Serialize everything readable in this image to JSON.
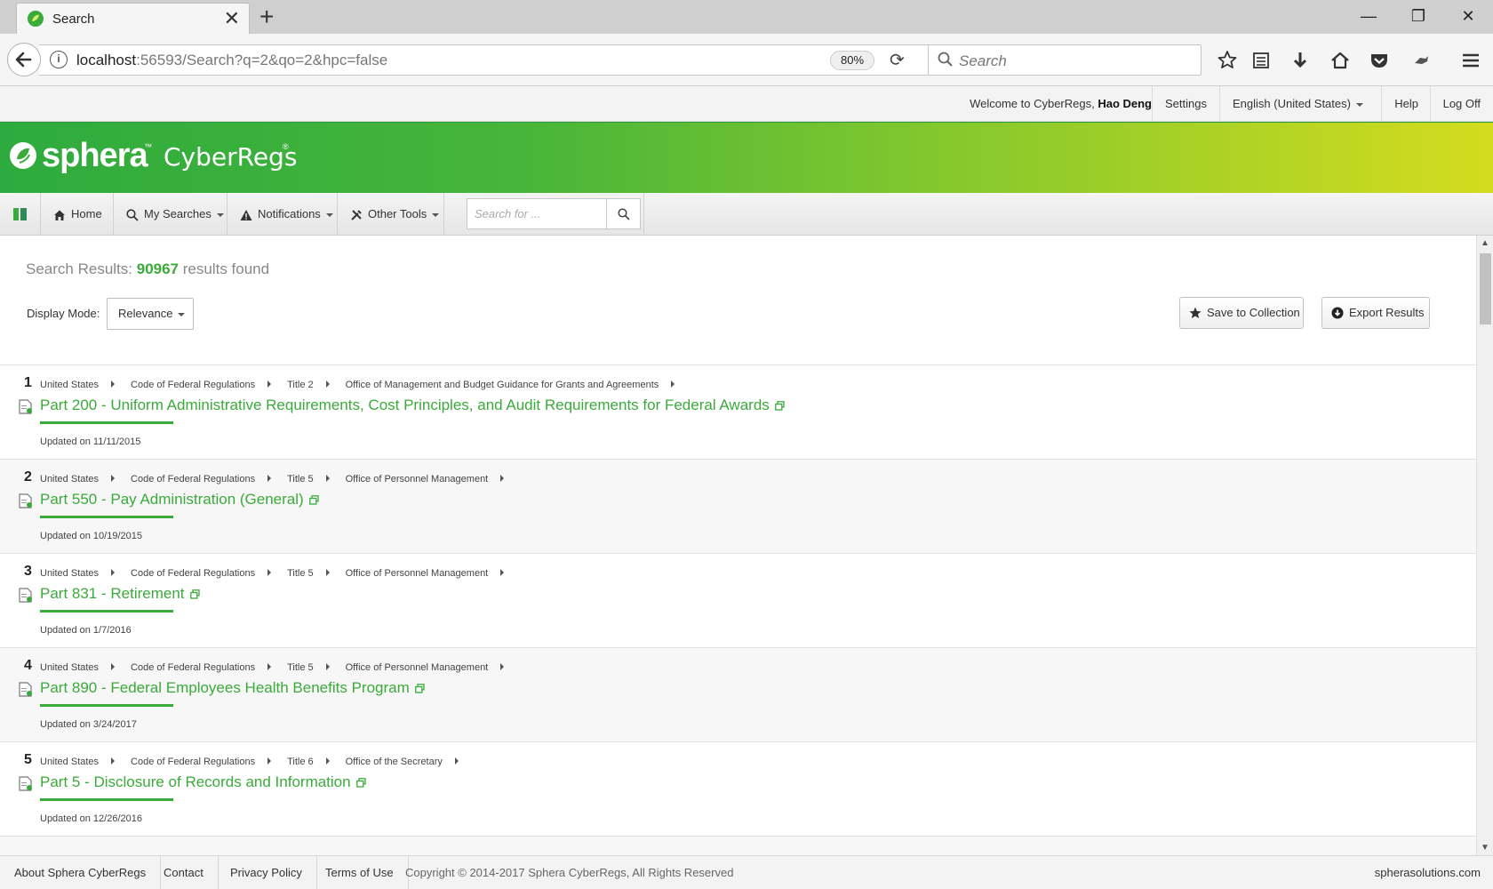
{
  "browser": {
    "tab_title": "Search",
    "url_host": "localhost",
    "url_rest": ":56593/Search?q=2&qo=2&hpc=false",
    "zoom": "80%",
    "search_placeholder": "Search"
  },
  "sitetop": {
    "welcome_prefix": "Welcome to CyberRegs, ",
    "user_name": "Hao Deng",
    "settings": "Settings",
    "language": "English (United States)",
    "help": "Help",
    "logoff": "Log Off"
  },
  "banner": {
    "brand": "sphera",
    "tm": "™",
    "product": "CyberRegs",
    "reg": "®"
  },
  "menu": {
    "home": "Home",
    "my_searches": "My Searches",
    "notifications": "Notifications",
    "other_tools": "Other Tools",
    "search_placeholder": "Search for ..."
  },
  "results_header": {
    "label": "Search Results:",
    "count": "90967",
    "suffix": "results found",
    "display_mode_label": "Display Mode:",
    "display_mode_value": "Relevance",
    "save_collection": "Save to Collection",
    "export_results": "Export Results"
  },
  "results": [
    {
      "num": "1",
      "crumbs": [
        "United States",
        "Code of Federal Regulations",
        "Title 2",
        "Office of Management and Budget Guidance for Grants and Agreements"
      ],
      "title": "Part 200 - Uniform Administrative Requirements, Cost Principles, and Audit Requirements for Federal Awards",
      "updated": "Updated on 11/11/2015"
    },
    {
      "num": "2",
      "crumbs": [
        "United States",
        "Code of Federal Regulations",
        "Title 5",
        "Office of Personnel Management"
      ],
      "title": "Part 550 - Pay Administration (General)",
      "updated": "Updated on 10/19/2015"
    },
    {
      "num": "3",
      "crumbs": [
        "United States",
        "Code of Federal Regulations",
        "Title 5",
        "Office of Personnel Management"
      ],
      "title": "Part 831 - Retirement",
      "updated": "Updated on 1/7/2016"
    },
    {
      "num": "4",
      "crumbs": [
        "United States",
        "Code of Federal Regulations",
        "Title 5",
        "Office of Personnel Management"
      ],
      "title": "Part 890 - Federal Employees Health Benefits Program",
      "updated": "Updated on 3/24/2017"
    },
    {
      "num": "5",
      "crumbs": [
        "United States",
        "Code of Federal Regulations",
        "Title 6",
        "Office of the Secretary"
      ],
      "title": "Part 5 - Disclosure of Records and Information",
      "updated": "Updated on 12/26/2016"
    }
  ],
  "footer": {
    "about": "About Sphera CyberRegs",
    "contact": "Contact",
    "privacy": "Privacy Policy",
    "terms": "Terms of Use",
    "copyright": "Copyright © 2014-2017 Sphera CyberRegs, All Rights Reserved",
    "site": "spherasolutions.com"
  },
  "colors": {
    "accent_green": "#3aab3a",
    "banner_start": "#2eab3e",
    "banner_end": "#d4dc1e"
  },
  "icons": {
    "tab_favicon": "sphera-leaf-icon",
    "result_doc": "document-icon",
    "result_external": "new-window-icon"
  }
}
